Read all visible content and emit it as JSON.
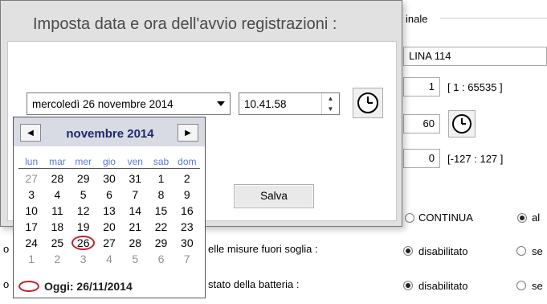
{
  "background": {
    "group_label": "inale",
    "name_value": "LINA 114",
    "field1_value": "1",
    "field1_range": "[ 1 : 65535 ]",
    "field2_value": "60",
    "field3_value": "0",
    "field3_range": "[-127 : 127 ]",
    "mode_continua": "CONTINUA",
    "mode_other": "al",
    "out_of_threshold_label": "elle misure fuori soglia :",
    "battery_label": "stato della batteria :",
    "disabled_label_1": "disabilitato",
    "disabled_label_2": "disabilitato",
    "se_label_1": "se",
    "se_label_2": "se",
    "left_letter_1": "o",
    "left_letter_2": "o"
  },
  "dialog": {
    "title": "Imposta data e ora dell'avvio registrazioni :",
    "date_value": "mercoledì 26 novembre 2014",
    "time_value": "10.41.58",
    "save_label": "Salva"
  },
  "calendar": {
    "month_label": "novembre 2014",
    "prev_icon": "◀",
    "next_icon": "▶",
    "weekdays": [
      "lun",
      "mar",
      "mer",
      "gio",
      "ven",
      "sab",
      "dom"
    ],
    "weeks": [
      [
        {
          "d": "27",
          "g": true
        },
        {
          "d": "28",
          "g": false
        },
        {
          "d": "29",
          "g": false
        },
        {
          "d": "30",
          "g": false
        },
        {
          "d": "31",
          "g": false
        },
        {
          "d": "1",
          "g": false
        },
        {
          "d": "2",
          "g": false
        }
      ],
      [
        {
          "d": "3",
          "g": false
        },
        {
          "d": "4",
          "g": false
        },
        {
          "d": "5",
          "g": false
        },
        {
          "d": "6",
          "g": false
        },
        {
          "d": "7",
          "g": false
        },
        {
          "d": "8",
          "g": false
        },
        {
          "d": "9",
          "g": false
        }
      ],
      [
        {
          "d": "10",
          "g": false
        },
        {
          "d": "11",
          "g": false
        },
        {
          "d": "12",
          "g": false
        },
        {
          "d": "13",
          "g": false
        },
        {
          "d": "14",
          "g": false
        },
        {
          "d": "15",
          "g": false
        },
        {
          "d": "16",
          "g": false
        }
      ],
      [
        {
          "d": "17",
          "g": false
        },
        {
          "d": "18",
          "g": false
        },
        {
          "d": "19",
          "g": false
        },
        {
          "d": "20",
          "g": false
        },
        {
          "d": "21",
          "g": false
        },
        {
          "d": "22",
          "g": false
        },
        {
          "d": "23",
          "g": false
        }
      ],
      [
        {
          "d": "24",
          "g": false
        },
        {
          "d": "25",
          "g": false
        },
        {
          "d": "26",
          "g": false,
          "today": true
        },
        {
          "d": "27",
          "g": false
        },
        {
          "d": "28",
          "g": false
        },
        {
          "d": "29",
          "g": false
        },
        {
          "d": "30",
          "g": false
        }
      ],
      [
        {
          "d": "1",
          "g": true
        },
        {
          "d": "2",
          "g": true
        },
        {
          "d": "3",
          "g": true
        },
        {
          "d": "4",
          "g": true
        },
        {
          "d": "5",
          "g": true
        },
        {
          "d": "6",
          "g": true
        },
        {
          "d": "7",
          "g": true
        }
      ]
    ],
    "today_label": "Oggi: 26/11/2014",
    "today_color": "#c0232b",
    "header_color": "#d8dbe4",
    "month_color": "#1c2a6c",
    "weekday_color": "#5a7bd0"
  }
}
